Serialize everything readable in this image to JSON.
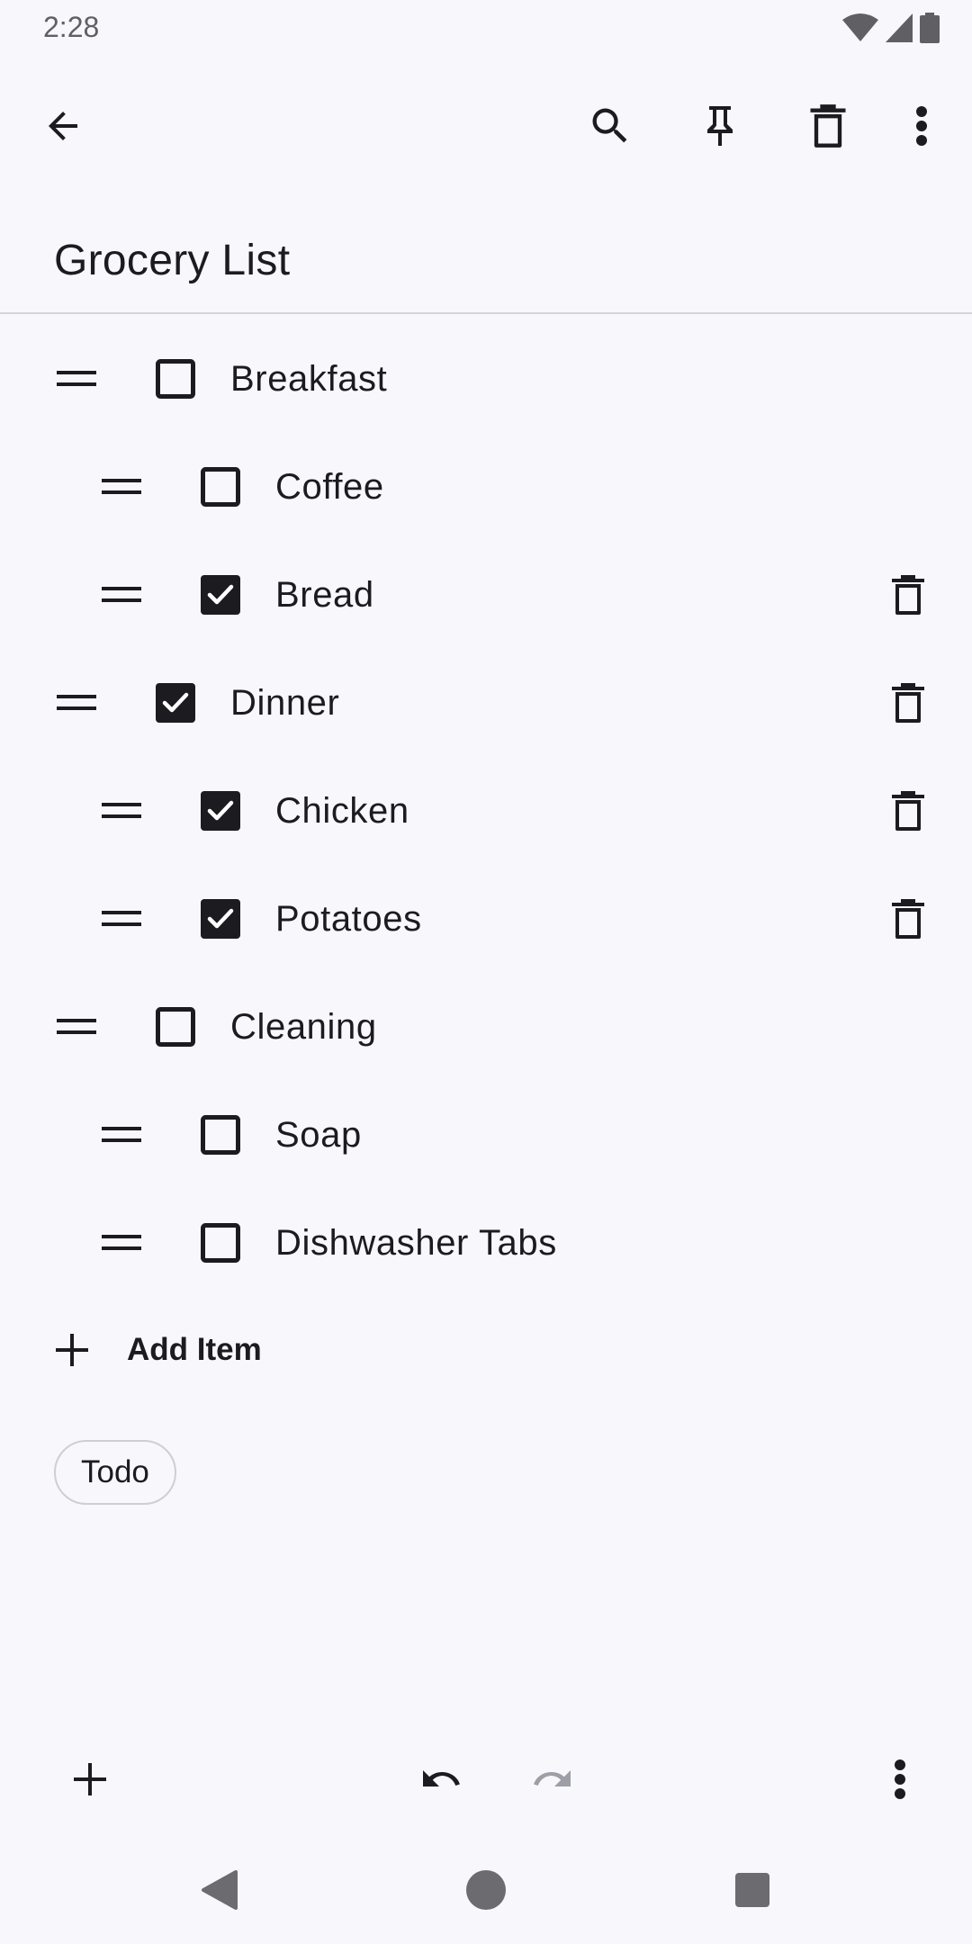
{
  "status_bar": {
    "time": "2:28"
  },
  "note": {
    "title": "Grocery List",
    "items": [
      {
        "label": "Breakfast",
        "checked": false,
        "level": 0
      },
      {
        "label": "Coffee",
        "checked": false,
        "level": 1
      },
      {
        "label": "Bread",
        "checked": true,
        "level": 1
      },
      {
        "label": "Dinner",
        "checked": true,
        "level": 0
      },
      {
        "label": "Chicken",
        "checked": true,
        "level": 1
      },
      {
        "label": "Potatoes",
        "checked": true,
        "level": 1
      },
      {
        "label": "Cleaning",
        "checked": false,
        "level": 0
      },
      {
        "label": "Soap",
        "checked": false,
        "level": 1
      },
      {
        "label": "Dishwasher Tabs",
        "checked": false,
        "level": 1
      }
    ],
    "add_item_label": "Add Item",
    "labels": [
      "Todo"
    ]
  },
  "colors": {
    "background": "#f8f7fc",
    "text": "#1c1b1f",
    "disabled": "#9e9ea6",
    "divider": "#d6d5db"
  },
  "icons": {
    "top_bar": [
      "back-arrow-icon",
      "search-icon",
      "pin-icon",
      "delete-icon",
      "more-vert-icon"
    ],
    "bottom_bar": [
      "add-icon",
      "undo-icon",
      "redo-icon",
      "more-vert-icon"
    ],
    "nav": [
      "nav-back-icon",
      "nav-home-icon",
      "nav-recents-icon"
    ]
  }
}
